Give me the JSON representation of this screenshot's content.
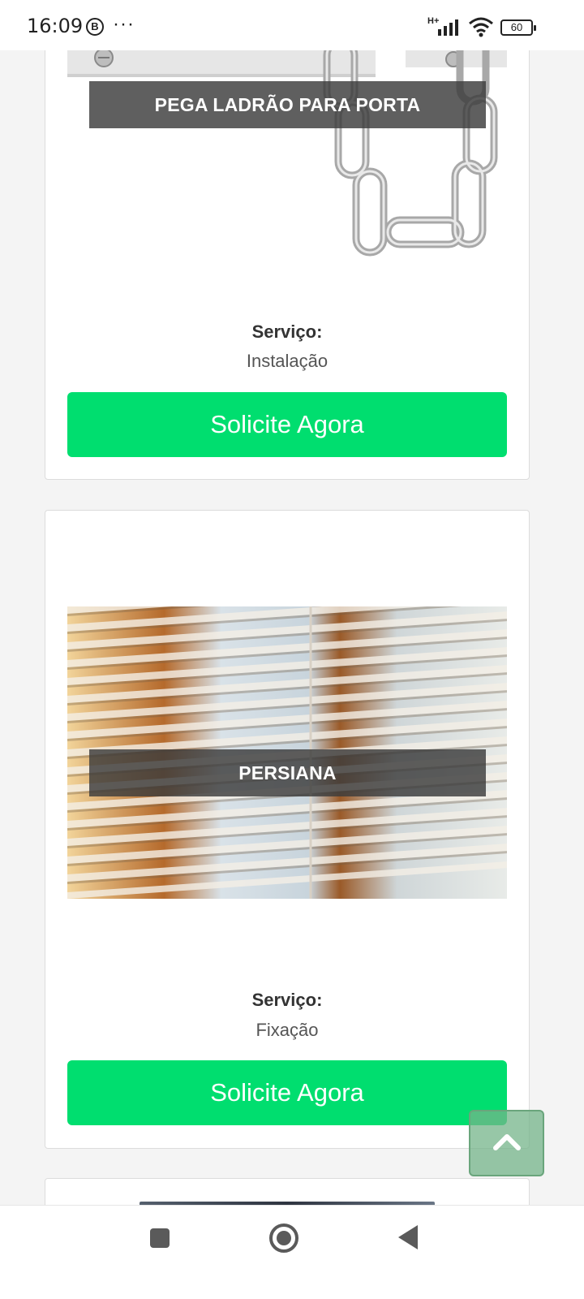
{
  "status_bar": {
    "time": "16:09",
    "b_icon": "B",
    "more": "···",
    "network_type": "H+",
    "battery": "60"
  },
  "cards": [
    {
      "caption": "PEGA LADRÃO PARA PORTA",
      "service_label": "Serviço:",
      "service_value": "Instalação",
      "button_label": "Solicite Agora",
      "image_icon": "door-chain-image"
    },
    {
      "caption": "PERSIANA",
      "service_label": "Serviço:",
      "service_value": "Fixação",
      "button_label": "Solicite Agora",
      "image_icon": "window-blinds-image"
    }
  ],
  "colors": {
    "button_green": "#00de6f",
    "back_to_top": "#74b489",
    "caption_bg": "#3c3c3c"
  },
  "icons": {
    "back_to_top": "chevron-up-icon",
    "nav_recent": "square-icon",
    "nav_home": "circle-icon",
    "nav_back": "triangle-back-icon"
  }
}
